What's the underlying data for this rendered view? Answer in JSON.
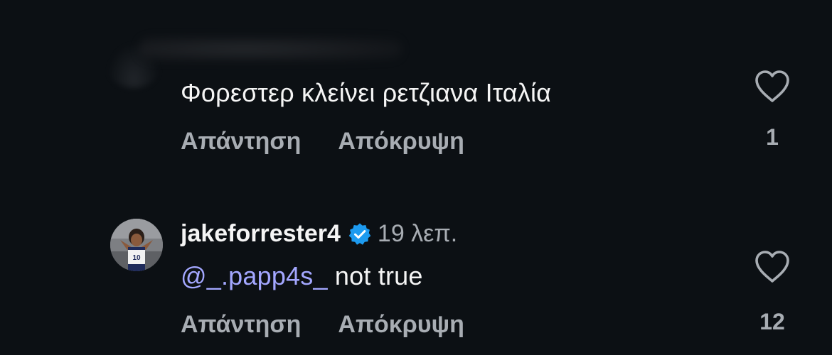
{
  "comment1": {
    "text": "Φορεστερ κλείνει ρετζιανα Ιταλία",
    "reply_label": "Απάντηση",
    "hide_label": "Απόκρυψη",
    "like_count": "1"
  },
  "comment2": {
    "username": "jakeforrester4",
    "verified": true,
    "timestamp": "19 λεπ.",
    "mention": "@_.papp4s_",
    "text": " not true",
    "reply_label": "Απάντηση",
    "hide_label": "Απόκρυψη",
    "like_count": "12",
    "avatar_icon": "basketball-player-avatar"
  },
  "colors": {
    "background": "#0c1014",
    "text": "#f5f5f5",
    "secondary": "#a8adb3",
    "mention": "#a3a7ff",
    "verified": "#1d9bf0"
  }
}
